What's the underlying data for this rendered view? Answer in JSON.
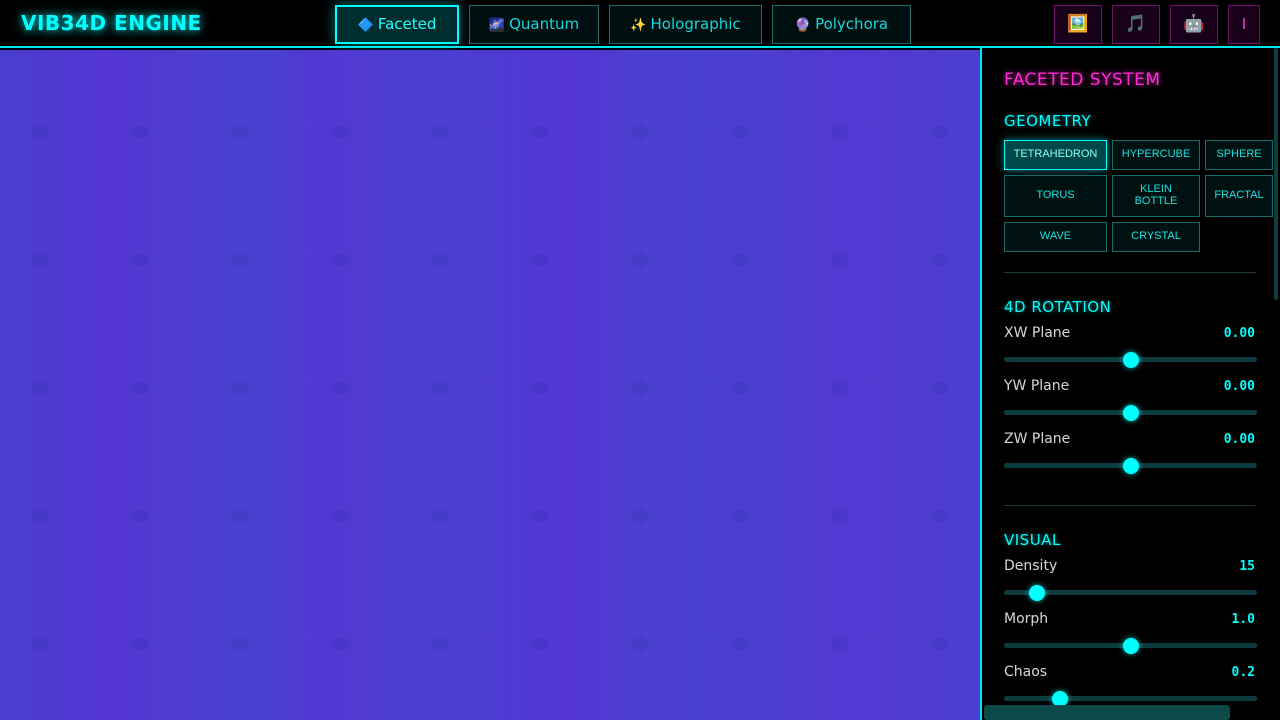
{
  "header": {
    "logo": "VIB34D ENGINE",
    "tabs": [
      {
        "icon": "🔷",
        "label": "Faceted",
        "active": true
      },
      {
        "icon": "🌌",
        "label": "Quantum",
        "active": false
      },
      {
        "icon": "✨",
        "label": "Holographic",
        "active": false
      },
      {
        "icon": "🔮",
        "label": "Polychora",
        "active": false
      }
    ],
    "actions": [
      {
        "icon": "🖼️",
        "name": "gallery-icon"
      },
      {
        "icon": "🎵",
        "name": "music-icon"
      },
      {
        "icon": "🤖",
        "name": "robot-icon"
      },
      {
        "icon": "I",
        "name": "info-icon"
      }
    ]
  },
  "panel": {
    "title": "FACETED SYSTEM",
    "geometry": {
      "title": "GEOMETRY",
      "options": [
        "TETRAHEDRON",
        "HYPERCUBE",
        "SPHERE",
        "TORUS",
        "KLEIN BOTTLE",
        "FRACTAL",
        "WAVE",
        "CRYSTAL"
      ],
      "selected": "TETRAHEDRON"
    },
    "rotation": {
      "title": "4D ROTATION",
      "sliders": [
        {
          "label": "XW Plane",
          "value": "0.00",
          "position": 0.5
        },
        {
          "label": "YW Plane",
          "value": "0.00",
          "position": 0.5
        },
        {
          "label": "ZW Plane",
          "value": "0.00",
          "position": 0.5
        }
      ]
    },
    "visual": {
      "title": "VISUAL",
      "sliders": [
        {
          "label": "Density",
          "value": "15",
          "position": 0.13
        },
        {
          "label": "Morph",
          "value": "1.0",
          "position": 0.5
        },
        {
          "label": "Chaos",
          "value": "0.2",
          "position": 0.22
        }
      ]
    }
  },
  "colors": {
    "accent": "#00ffff",
    "title_magenta": "#ff2bd6",
    "canvas": "#4b3fd0"
  }
}
